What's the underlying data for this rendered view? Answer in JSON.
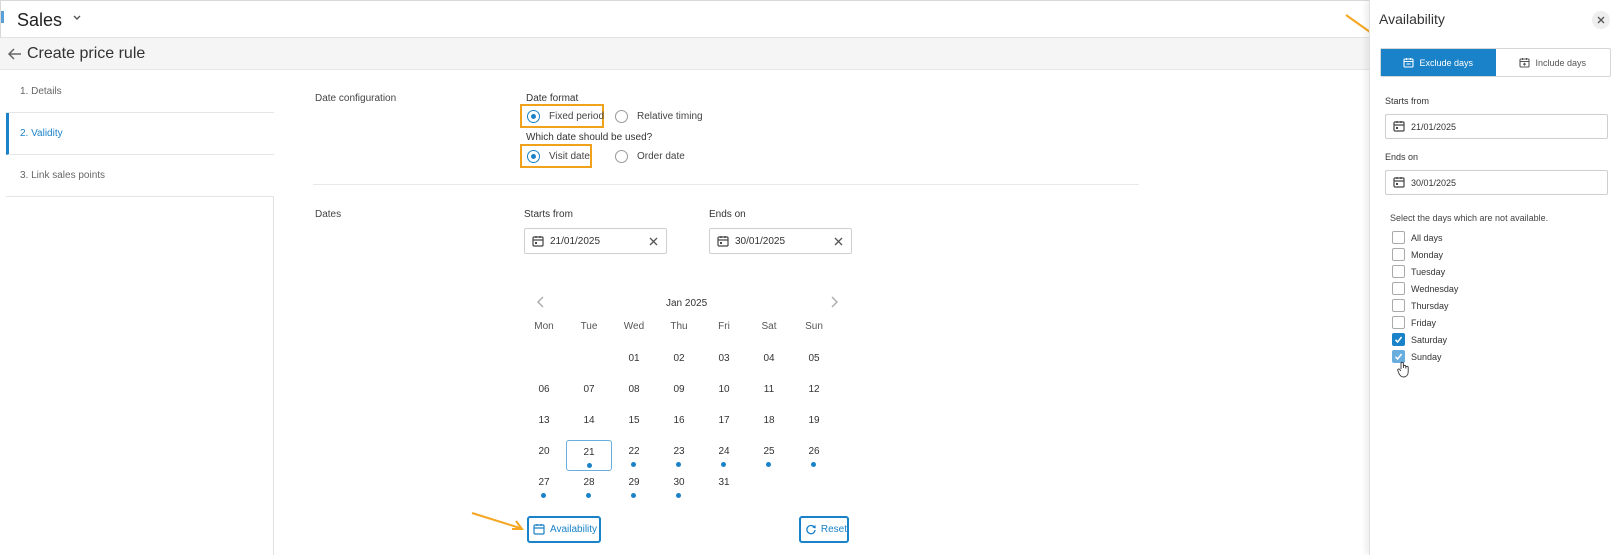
{
  "app": {
    "title": "Sales"
  },
  "page": {
    "title": "Create price rule"
  },
  "steps": [
    {
      "label": "1. Details",
      "active": false
    },
    {
      "label": "2. Validity",
      "active": true
    },
    {
      "label": "3. Link sales points",
      "active": false
    }
  ],
  "date_config": {
    "section": "Date configuration",
    "format_label": "Date format",
    "format_options": [
      "Fixed period",
      "Relative timing"
    ],
    "format_selected": "Fixed period",
    "which_label": "Which date should be used?",
    "which_options": [
      "Visit date",
      "Order date"
    ],
    "which_selected": "Visit date"
  },
  "dates": {
    "section": "Dates",
    "starts_label": "Starts from",
    "starts_value": "21/01/2025",
    "ends_label": "Ends on",
    "ends_value": "30/01/2025"
  },
  "calendar": {
    "month": "Jan 2025",
    "weekdays": [
      "Mon",
      "Tue",
      "Wed",
      "Thu",
      "Fri",
      "Sat",
      "Sun"
    ],
    "weeks": [
      [
        "",
        "",
        "01",
        "02",
        "03",
        "04",
        "05"
      ],
      [
        "06",
        "07",
        "08",
        "09",
        "10",
        "11",
        "12"
      ],
      [
        "13",
        "14",
        "15",
        "16",
        "17",
        "18",
        "19"
      ],
      [
        "20",
        "21",
        "22",
        "23",
        "24",
        "25",
        "26"
      ],
      [
        "27",
        "28",
        "29",
        "30",
        "31",
        "",
        ""
      ]
    ],
    "today": "21",
    "marked_days": [
      "21",
      "22",
      "23",
      "24",
      "25",
      "26",
      "27",
      "28",
      "29",
      "30"
    ]
  },
  "buttons": {
    "availability": "Availability",
    "reset": "Reset"
  },
  "panel": {
    "title": "Availability",
    "tabs": [
      "Exclude days",
      "Include days"
    ],
    "active_tab": "Exclude days",
    "starts_label": "Starts from",
    "starts_value": "21/01/2025",
    "ends_label": "Ends on",
    "ends_value": "30/01/2025",
    "hint": "Select the days which are not available.",
    "days": [
      {
        "label": "All days",
        "checked": false
      },
      {
        "label": "Monday",
        "checked": false
      },
      {
        "label": "Tuesday",
        "checked": false
      },
      {
        "label": "Wednesday",
        "checked": false
      },
      {
        "label": "Thursday",
        "checked": false
      },
      {
        "label": "Friday",
        "checked": false
      },
      {
        "label": "Saturday",
        "checked": true
      },
      {
        "label": "Sunday",
        "checked": true
      }
    ]
  },
  "colors": {
    "accent": "#1a82c8",
    "highlight": "#f0a21a"
  }
}
